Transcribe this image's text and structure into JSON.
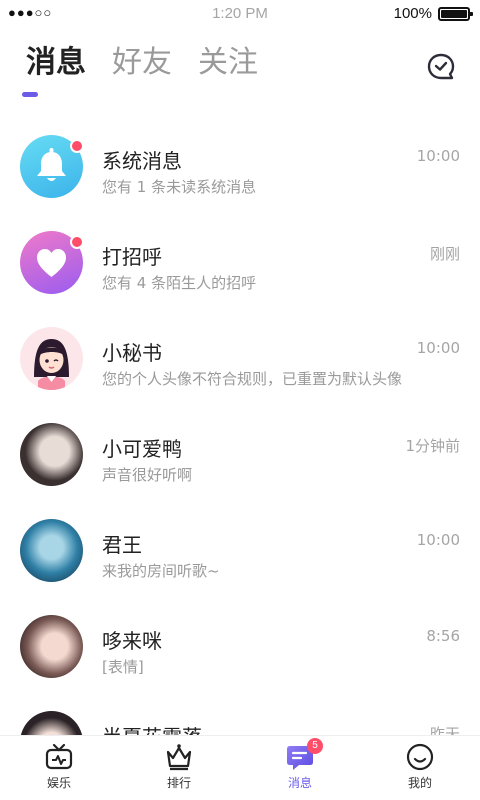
{
  "status_bar": {
    "signal": "●●●○○",
    "time": "1:20 PM",
    "battery": "100%"
  },
  "header": {
    "tabs": [
      {
        "label": "消息",
        "active": true
      },
      {
        "label": "好友",
        "active": false
      },
      {
        "label": "关注",
        "active": false
      }
    ],
    "indicator_color": "#6b5ce7"
  },
  "conversations": [
    {
      "name": "系统消息",
      "preview": "您有 1 条未读系统消息",
      "time": "10:00",
      "unread_dot": true,
      "avatar": "bell-icon"
    },
    {
      "name": "打招呼",
      "preview": "您有 4 条陌生人的招呼",
      "time": "刚刚",
      "unread_dot": true,
      "avatar": "heart-icon"
    },
    {
      "name": "小秘书",
      "preview": "您的个人头像不符合规则，已重置为默认头像",
      "time": "10:00",
      "unread_dot": false,
      "avatar": "assistant-avatar"
    },
    {
      "name": "小可爱鸭",
      "preview": "声音很好听啊",
      "time": "1分钟前",
      "unread_dot": false,
      "avatar": "user-avatar"
    },
    {
      "name": "君王",
      "preview": "来我的房间听歌~",
      "time": "10:00",
      "unread_dot": false,
      "avatar": "user-avatar"
    },
    {
      "name": "哆来咪",
      "preview": "[表情]",
      "time": "8:56",
      "unread_dot": false,
      "avatar": "user-avatar"
    },
    {
      "name": "半夏花零落",
      "preview": "",
      "time": "昨天",
      "unread_dot": false,
      "avatar": "user-avatar"
    }
  ],
  "bottom_nav": {
    "items": [
      {
        "label": "娱乐",
        "icon": "tv-icon"
      },
      {
        "label": "排行",
        "icon": "crown-icon"
      },
      {
        "label": "消息",
        "icon": "chat-icon",
        "badge": "5",
        "active": true
      },
      {
        "label": "我的",
        "icon": "smile-icon"
      }
    ]
  }
}
